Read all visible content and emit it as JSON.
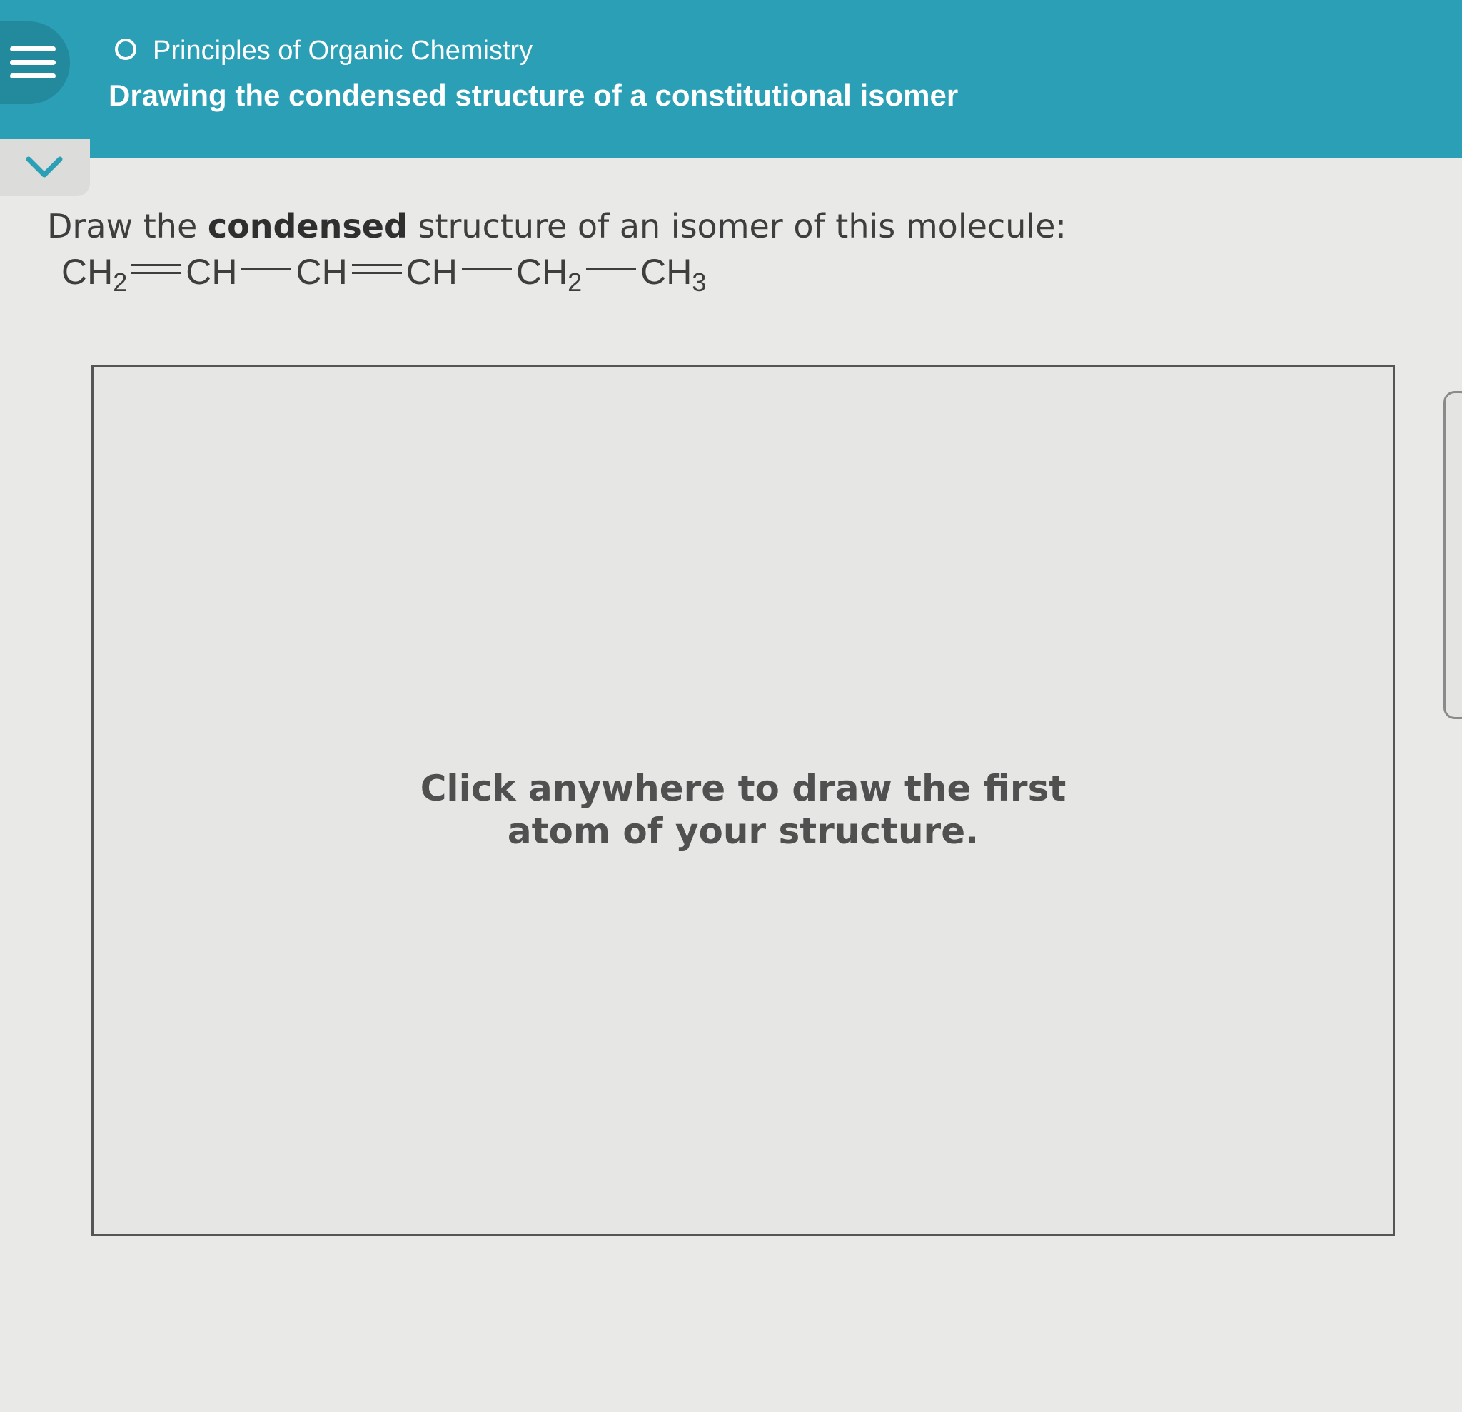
{
  "header": {
    "topic": "Principles of Organic Chemistry",
    "title": "Drawing the condensed structure of a constitutional isomer",
    "color": "#2a9fb5"
  },
  "question": {
    "prompt_before": "Draw the ",
    "prompt_bold": "condensed",
    "prompt_after": " structure of an isomer of this molecule:",
    "formula": [
      {
        "text": "CH",
        "sub": "2"
      },
      {
        "bond": "double"
      },
      {
        "text": "CH",
        "sub": ""
      },
      {
        "bond": "single"
      },
      {
        "text": "CH",
        "sub": ""
      },
      {
        "bond": "double"
      },
      {
        "text": "CH",
        "sub": ""
      },
      {
        "bond": "single"
      },
      {
        "text": "CH",
        "sub": "2"
      },
      {
        "bond": "single"
      },
      {
        "text": "CH",
        "sub": "3"
      }
    ]
  },
  "canvas": {
    "hint_line1": "Click anywhere to draw the first",
    "hint_line2": "atom of your structure."
  },
  "icons": {
    "menu": "hamburger-menu-icon",
    "topic": "circle-outline-icon",
    "collapse": "chevron-down-icon"
  }
}
